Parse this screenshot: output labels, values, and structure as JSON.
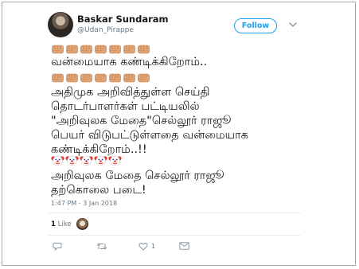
{
  "user": {
    "name": "Baskar Sundaram",
    "handle": "@Udan_Pirappe",
    "follow_label": "Follow"
  },
  "tweet": {
    "lines": [
      "வன்மையாக கண்டிக்கிறோம்..",
      "அதிமுக அறிவித்துள்ள செய்தி",
      "தொடர்பாளர்கள் பட்டியலில்",
      "\"அறிவுலக மேதை\"செல்லூர் ராஜூ",
      "பெயர் விடுபட்டுள்ளதை வன்மையாக",
      "கண்டிக்கிறோம்..!!",
      "அறிவுலக மேதை செல்லூர் ராஜூ",
      "தற்கொலை படை!"
    ],
    "emoji_rows": [
      {
        "icon": "fist-emoji",
        "count": 7
      },
      {
        "icon": "fist-emoji",
        "count": 7
      },
      {
        "icon": "clown-emoji",
        "count": 5
      }
    ],
    "timestamp": "1:47 PM - 3 Jan 2018"
  },
  "stats": {
    "likes_count": "1",
    "likes_label": "Like"
  },
  "actions": [
    {
      "icon": "reply-icon",
      "count": ""
    },
    {
      "icon": "retweet-icon",
      "count": ""
    },
    {
      "icon": "like-icon",
      "count": "1"
    },
    {
      "icon": "message-icon",
      "count": ""
    }
  ],
  "colors": {
    "accent": "#1da1f2",
    "text": "#14171a",
    "muted": "#657786",
    "fist": "#e0a576",
    "clown_face": "#ffffff",
    "clown_hair": "#e53935"
  }
}
